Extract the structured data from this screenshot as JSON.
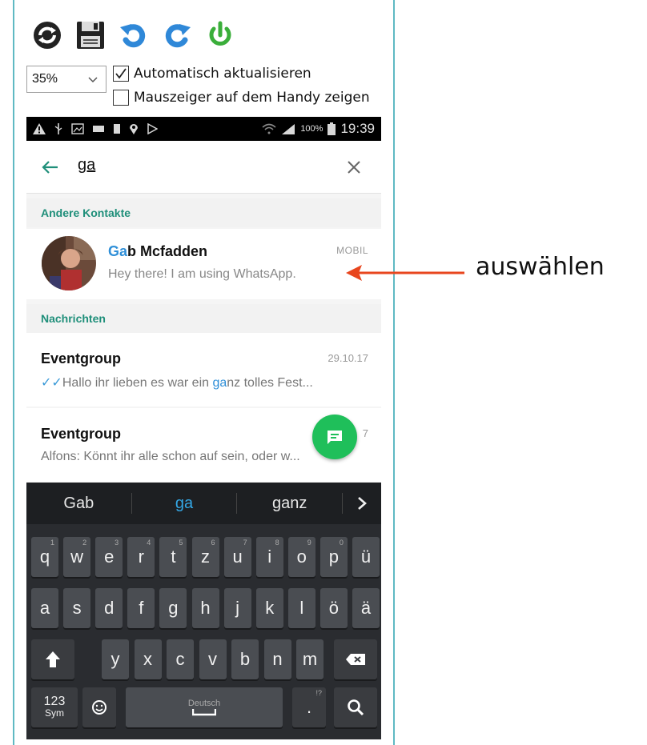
{
  "toolbar": {
    "buttons": [
      {
        "name": "refresh-icon"
      },
      {
        "name": "save-icon"
      },
      {
        "name": "undo-icon"
      },
      {
        "name": "redo-icon"
      },
      {
        "name": "power-icon"
      }
    ],
    "zoom_value": "35%",
    "auto_refresh_label": "Automatisch aktualisieren",
    "auto_refresh_checked": true,
    "show_pointer_label": "Mauszeiger auf dem Handy zeigen",
    "show_pointer_checked": false
  },
  "statusbar": {
    "battery": "100%",
    "time": "19:39"
  },
  "search": {
    "query": "ga"
  },
  "sections": {
    "contacts": "Andere Kontakte",
    "messages": "Nachrichten"
  },
  "contact": {
    "name_highlight": "Ga",
    "name_rest": "b Mcfadden",
    "status": "Hey there! I am using WhatsApp.",
    "tag": "MOBIL"
  },
  "messages": [
    {
      "title": "Eventgroup",
      "date": "29.10.17",
      "preview_before": "Hallo  ihr  lieben  es war ein ",
      "preview_highlight": "ga",
      "preview_after": "nz  tolles Fest...",
      "ticks": "✓✓"
    },
    {
      "title": "Eventgroup",
      "date": "7",
      "preview": "Alfons: Könnt ihr alle schon auf sein, oder w..."
    }
  ],
  "keyboard": {
    "suggestions": [
      "Gab",
      "ga",
      "ganz"
    ],
    "row1": [
      "q",
      "w",
      "e",
      "r",
      "t",
      "z",
      "u",
      "i",
      "o",
      "p",
      "ü"
    ],
    "row1_nums": [
      "1",
      "2",
      "3",
      "4",
      "5",
      "6",
      "7",
      "8",
      "9",
      "0",
      ""
    ],
    "row2": [
      "a",
      "s",
      "d",
      "f",
      "g",
      "h",
      "j",
      "k",
      "l",
      "ö",
      "ä"
    ],
    "row3": [
      "y",
      "x",
      "c",
      "v",
      "b",
      "n",
      "m"
    ],
    "sym_top": "123",
    "sym_bottom": "Sym",
    "space_label": "Deutsch",
    "period": ".",
    "period_sup": "!?"
  },
  "annotation": {
    "text": "auswählen",
    "color": "#e8461e"
  },
  "colors": {
    "accent": "#1f8f7a",
    "highlight": "#2f8fd8",
    "fab": "#1fbf5a"
  }
}
